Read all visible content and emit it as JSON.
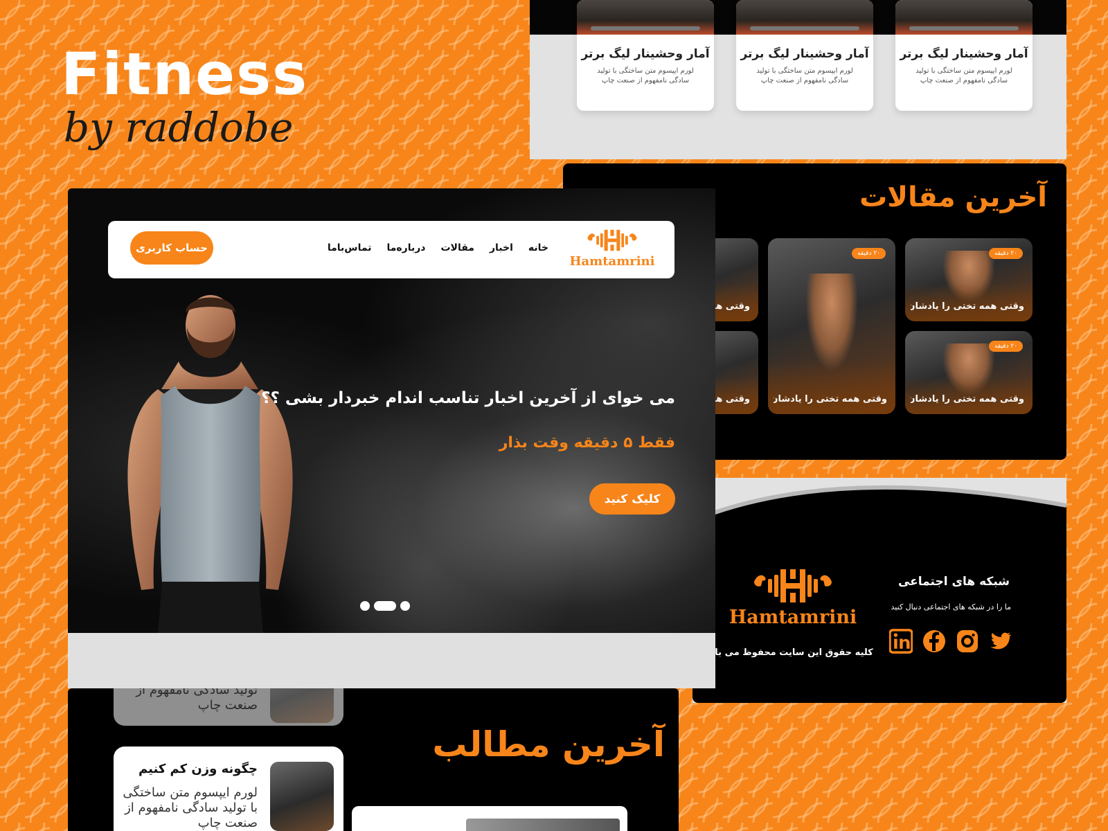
{
  "showcase": {
    "title": "Fitness",
    "byline": "by raddobe"
  },
  "colors": {
    "accent": "#f7851a",
    "dark": "#000000",
    "light_panel": "#e2e2e2"
  },
  "stat_cards": [
    {
      "title": "آمار وحشینار لیگ برتر",
      "text": "لورم ایپسوم متن ساختگی با تولید سادگی نامفهوم از صنعت چاپ"
    },
    {
      "title": "آمار وحشینار لیگ برتر",
      "text": "لورم ایپسوم متن ساختگی با تولید سادگی نامفهوم از صنعت چاپ"
    },
    {
      "title": "آمار وحشینار لیگ برتر",
      "text": "لورم ایپسوم متن ساختگی با تولید سادگی نامفهوم از صنعت چاپ"
    }
  ],
  "articles": {
    "title": "آخرین مقالات",
    "cards": [
      {
        "badge": "۲۰ دقیقه",
        "caption": "وقتی همه تختی را یادشان رفت!"
      },
      {
        "badge": "۲۰ دقیقه",
        "caption": "وقتی همه تختی را یادشان رفت!"
      },
      {
        "badge": "۲۰ دقیقه",
        "caption": "وقتی همه تختی را یادشان رفت!"
      },
      {
        "caption": "وقتی همه"
      },
      {
        "caption": "وقتی هم"
      }
    ]
  },
  "footer": {
    "social_title": "شبکه های اجتماعی",
    "social_sub": "ما را در شبکه های اجتماعی دنبال کنید",
    "logo_text": "Hamtamrini",
    "copyright": "کلیه حقوق این سایت محفوظ می باشد",
    "social_icons": [
      "twitter-icon",
      "instagram-icon",
      "facebook-icon",
      "linkedin-icon"
    ]
  },
  "navbar": {
    "logo_text": "Hamtamrini",
    "links": [
      "خانه",
      "اخبار",
      "مقالات",
      "درباره‌ما",
      "تماس‌باما"
    ],
    "account_label": "حساب کاربری"
  },
  "hero": {
    "headline": "می خوای از آخرین اخبار تناسب اندام خبردار بشی ؟؟",
    "sub": "فقط ۵ دقیقه وقت بذار",
    "cta": "کلیک کنید",
    "slides": 3,
    "active_slide": 2
  },
  "posts": {
    "title": "آخرین مطالب",
    "card_top_text": "تولید سادگی نامفهوم از صنعت چاپ",
    "card": {
      "title": "چگونه وزن کم کنیم",
      "text": "لورم ایپسوم متن ساختگی با تولید سادگی نامفهوم از صنعت چاپ"
    }
  }
}
